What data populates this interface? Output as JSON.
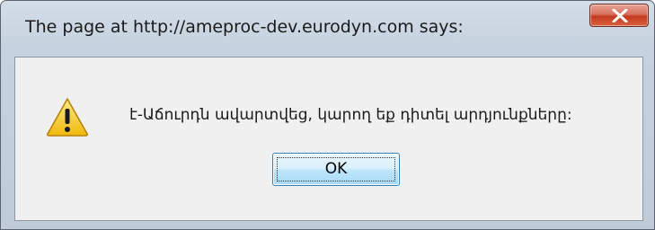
{
  "dialog": {
    "title": "The page at http://ameproc-dev.eurodyn.com says:",
    "message": "է-Աճուրդն ավարտվեց, կարող եք դիտել արդյունքները:",
    "ok_label": "OK",
    "close_glyph": "X",
    "icon": "warning-icon"
  },
  "colors": {
    "titlebar": "#c6d2df",
    "close_button": "#c43a20",
    "client_background": "#f0f0f0",
    "ok_button_border": "#3c7fb1",
    "warning_fill": "#f5c518"
  }
}
